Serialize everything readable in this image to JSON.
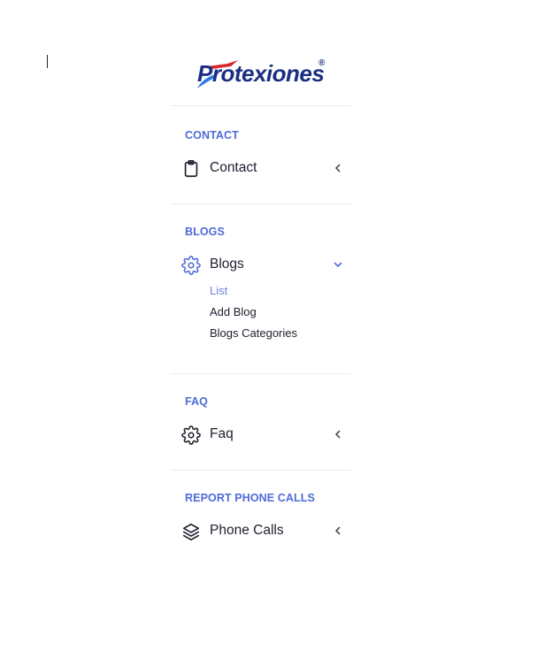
{
  "brand": {
    "name": "Protexiones",
    "reg_mark": "®",
    "color": "#1b2f82",
    "accent": "#4e6bd9"
  },
  "sections": [
    {
      "title": "CONTACT",
      "item": {
        "label": "Contact",
        "icon": "clipboard-icon",
        "expanded": false
      }
    },
    {
      "title": "BLOGS",
      "item": {
        "label": "Blogs",
        "icon": "gear-icon",
        "expanded": true,
        "subitems": [
          {
            "label": "List",
            "active": true
          },
          {
            "label": "Add Blog",
            "active": false
          },
          {
            "label": "Blogs Categories",
            "active": false
          }
        ]
      }
    },
    {
      "title": "FAQ",
      "item": {
        "label": "Faq",
        "icon": "gear-icon",
        "expanded": false
      }
    },
    {
      "title": "REPORT PHONE CALLS",
      "item": {
        "label": "Phone Calls",
        "icon": "layers-icon",
        "expanded": false
      }
    }
  ]
}
